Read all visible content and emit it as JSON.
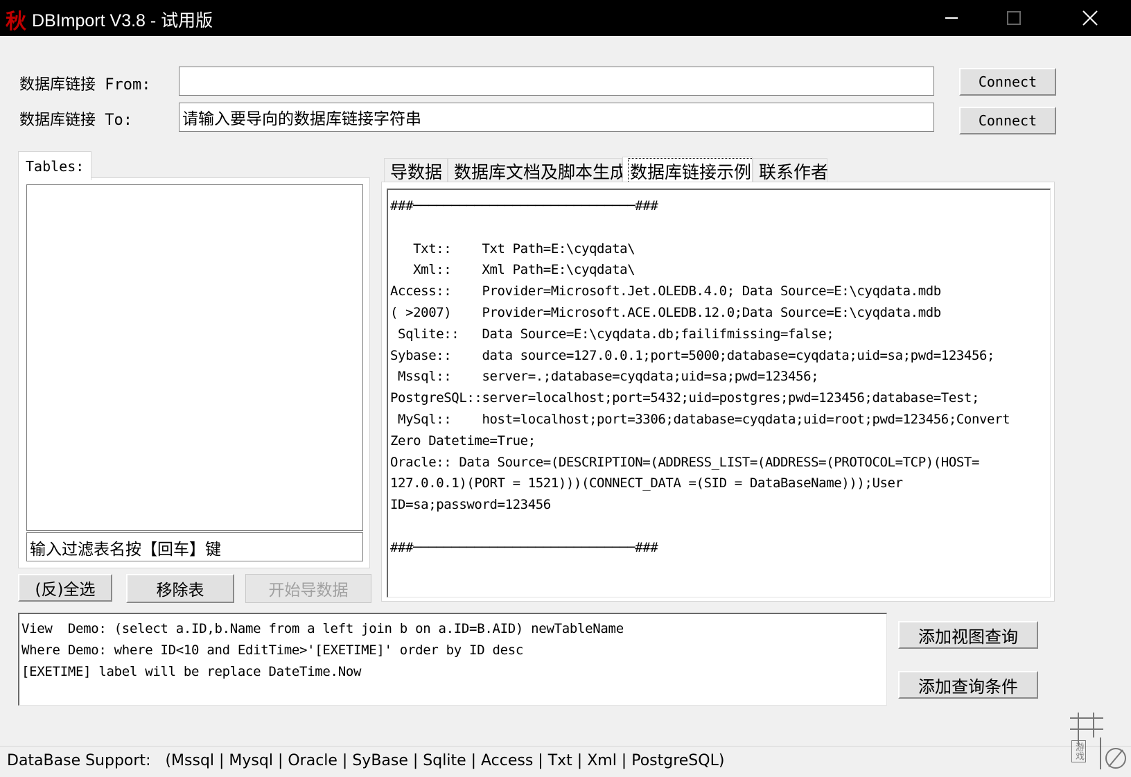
{
  "window": {
    "icon_text": "秋",
    "title": "DBImport V3.8 - 试用版"
  },
  "connection": {
    "from_label": "数据库链接 From:",
    "from_value": "",
    "to_label": "数据库链接 To:",
    "to_value": "请输入要导向的数据库链接字符串",
    "connect_from_label": "Connect",
    "connect_to_label": "Connect"
  },
  "tables": {
    "tab_label": "Tables:",
    "filter_placeholder": "输入过滤表名按【回车】键",
    "toggle_select_label": "(反)全选",
    "remove_label": "移除表",
    "start_import_label": "开始导数据"
  },
  "tabs": [
    {
      "label": "导数据",
      "active": false
    },
    {
      "label": "数据库文档及脚本生成",
      "active": false
    },
    {
      "label": "数据库链接示例",
      "active": true
    },
    {
      "label": "联系作者",
      "active": false
    }
  ],
  "examples_text": "###─────────────────────────────###\n\n   Txt::    Txt Path=E:\\cyqdata\\\n   Xml::    Xml Path=E:\\cyqdata\\\nAccess::    Provider=Microsoft.Jet.OLEDB.4.0; Data Source=E:\\cyqdata.mdb\n( >2007)    Provider=Microsoft.ACE.OLEDB.12.0;Data Source=E:\\cyqdata.mdb\n Sqlite::   Data Source=E:\\cyqdata.db;failifmissing=false;\nSybase::    data source=127.0.0.1;port=5000;database=cyqdata;uid=sa;pwd=123456;\n Mssql::    server=.;database=cyqdata;uid=sa;pwd=123456;\nPostgreSQL::server=localhost;port=5432;uid=postgres;pwd=123456;database=Test;\n MySql::    host=localhost;port=3306;database=cyqdata;uid=root;pwd=123456;Convert\nZero Datetime=True;\nOracle:: Data Source=(DESCRIPTION=(ADDRESS_LIST=(ADDRESS=(PROTOCOL=TCP)(HOST=\n127.0.0.1)(PORT = 1521)))(CONNECT_DATA =(SID = DataBaseName)));User\nID=sa;password=123456\n\n###─────────────────────────────###",
  "query": {
    "text": "View  Demo: (select a.ID,b.Name from a left join b on a.ID=B.AID) newTableName\nWhere Demo: where ID<10 and EditTime>'[EXETIME]' order by ID desc\n[EXETIME] label will be replace DateTime.Now",
    "add_view_label": "添加视图查询",
    "add_condition_label": "添加查询条件"
  },
  "status": {
    "text": "DataBase Support:   (Mssql | Mysql | Oracle | SyBase | Sqlite | Access | Txt | Xml | PostgreSQL)"
  },
  "watermark": {
    "text": "游戏"
  }
}
